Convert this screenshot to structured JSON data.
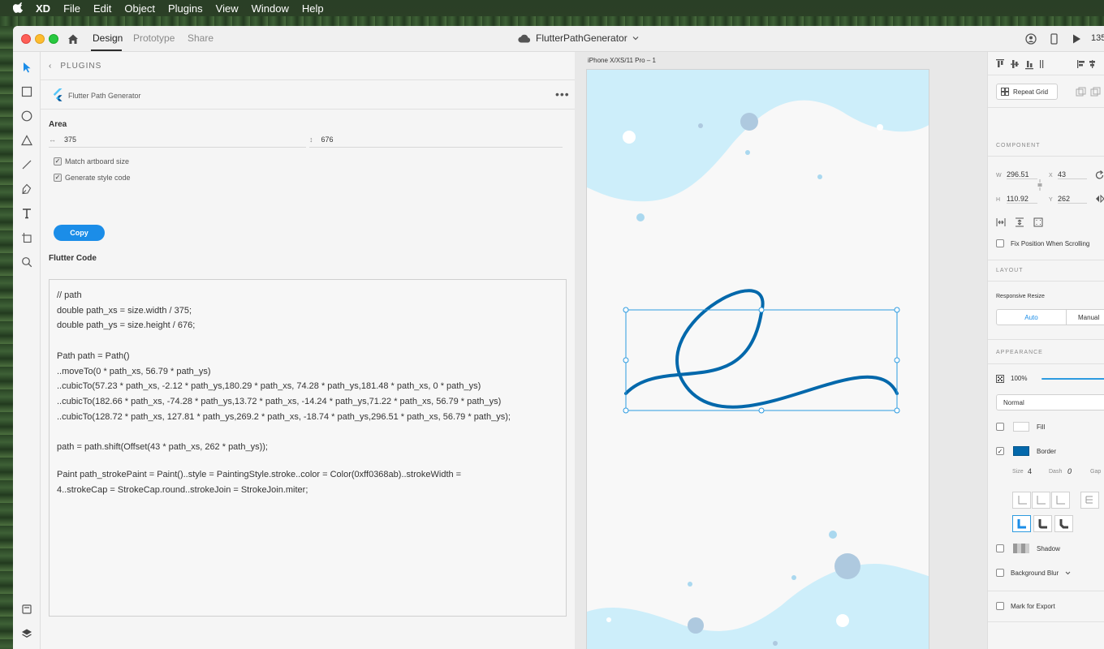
{
  "menubar": {
    "app": "XD",
    "items": [
      "File",
      "Edit",
      "Object",
      "Plugins",
      "View",
      "Window",
      "Help"
    ]
  },
  "titlebar": {
    "tabs": [
      "Design",
      "Prototype",
      "Share"
    ],
    "active_tab": "Design",
    "document_title": "FlutterPathGenerator",
    "zoom": "135"
  },
  "plugin_panel": {
    "back_label": "PLUGINS",
    "plugin_name": "Flutter Path Generator",
    "area_heading": "Area",
    "width_value": "375",
    "height_value": "676",
    "match_artboard_label": "Match artboard size",
    "match_artboard_checked": true,
    "generate_style_label": "Generate style code",
    "generate_style_checked": true,
    "copy_label": "Copy",
    "code_heading": "Flutter Code",
    "code_lines": [
      "// path",
      "double path_xs = size.width / 375;",
      "double path_ys = size.height / 676;",
      "",
      "Path path = Path()",
      "..moveTo(0 * path_xs, 56.79 * path_ys)",
      "..cubicTo(57.23 * path_xs, -2.12 * path_ys,180.29 * path_xs, 74.28 * path_ys,181.48 * path_xs, 0 * path_ys)",
      "..cubicTo(182.66 * path_xs, -74.28 * path_ys,13.72 * path_xs, -14.24 * path_ys,71.22 * path_xs, 56.79 * path_ys)",
      "..cubicTo(128.72 * path_xs, 127.81 * path_ys,269.2 * path_xs, -18.74 * path_ys,296.51 * path_xs, 56.79 * path_ys);",
      "",
      "path = path.shift(Offset(43 * path_xs, 262 * path_ys));",
      "",
      "Paint path_strokePaint = Paint()..style = PaintingStyle.stroke..color = Color(0xff0368ab)..strokeWidth =",
      "4..strokeCap = StrokeCap.round..strokeJoin = StrokeJoin.miter;"
    ]
  },
  "canvas": {
    "artboard_label": "iPhone X/XS/11 Pro – 1",
    "wave_color": "#cdeefa",
    "path_color": "#0368ab",
    "selection_color": "#2d9be0"
  },
  "properties": {
    "repeat_grid_label": "Repeat Grid",
    "component_header": "COMPONENT",
    "w_label": "W",
    "w_value": "296.51",
    "x_label": "X",
    "x_value": "43",
    "h_label": "H",
    "h_value": "110.92",
    "y_label": "Y",
    "y_value": "262",
    "fix_position_label": "Fix Position When Scrolling",
    "layout_header": "LAYOUT",
    "responsive_resize_label": "Responsive Resize",
    "auto_label": "Auto",
    "manual_label": "Manual",
    "appearance_header": "APPEARANCE",
    "opacity_value": "100%",
    "blend_mode": "Normal",
    "fill_label": "Fill",
    "fill_checked": false,
    "border_label": "Border",
    "border_checked": true,
    "border_color": "#0368ab",
    "size_label": "Size",
    "size_value": "4",
    "dash_label": "Dash",
    "dash_value": "0",
    "gap_label": "Gap",
    "shadow_label": "Shadow",
    "background_blur_label": "Background Blur",
    "mark_for_export_label": "Mark for Export"
  }
}
